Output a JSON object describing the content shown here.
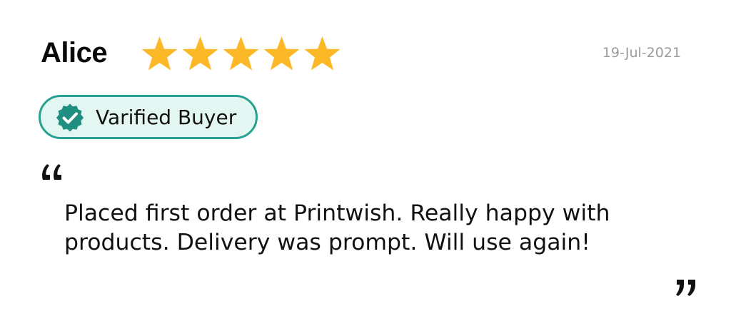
{
  "review": {
    "reviewer_name": "Alice",
    "date": "19-Jul-2021",
    "rating": 5,
    "rating_max": 5,
    "badge_label": "Varified Buyer",
    "text": "Placed first order at Printwish. Really happy with products. Delivery was prompt. Will use again!"
  },
  "icons": {
    "star": "star-icon",
    "verified": "verified-check-icon",
    "quote_open": "open-quote-icon",
    "quote_close": "close-quote-icon"
  },
  "colors": {
    "star": "#fdb827",
    "badge_border": "#27a192",
    "badge_background": "#e3f7f2",
    "badge_icon": "#1f8f82",
    "date_text": "#9b9b9b",
    "primary_text": "#111111"
  }
}
